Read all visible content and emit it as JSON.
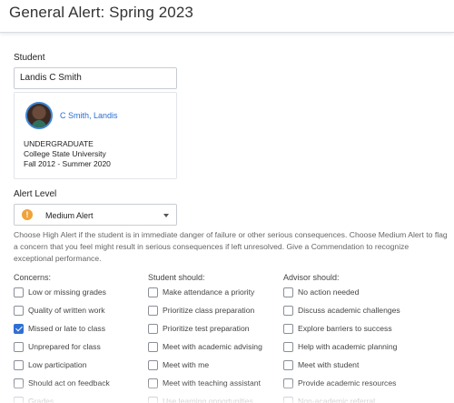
{
  "header": {
    "title": "General Alert: Spring 2023"
  },
  "student": {
    "label": "Student",
    "value": "Landis  C Smith",
    "card": {
      "name": "C Smith, Landis",
      "level": "UNDERGRADUATE",
      "school": "College State University",
      "term": "Fall 2012 - Summer 2020"
    }
  },
  "alert_level": {
    "label": "Alert Level",
    "selected": "Medium Alert",
    "icon": "warning-icon",
    "icon_color": "#f0a23a",
    "help": "Choose High Alert if the student is in immediate danger of failure or other serious consequences. Choose Medium Alert to flag a concern that you feel might result in serious consequences if left unresolved. Give a Commendation to recognize exceptional performance."
  },
  "columns": {
    "concerns": {
      "header": "Concerns:",
      "items": [
        {
          "label": "Low or missing grades",
          "checked": false
        },
        {
          "label": "Quality of written work",
          "checked": false
        },
        {
          "label": "Missed or late to class",
          "checked": true
        },
        {
          "label": "Unprepared for class",
          "checked": false
        },
        {
          "label": "Low participation",
          "checked": false
        },
        {
          "label": "Should act on feedback",
          "checked": false
        },
        {
          "label": "Grades",
          "checked": false
        }
      ]
    },
    "student_should": {
      "header": "Student should:",
      "items": [
        {
          "label": "Make attendance a priority",
          "checked": false
        },
        {
          "label": "Prioritize class preparation",
          "checked": false
        },
        {
          "label": "Prioritize test preparation",
          "checked": false
        },
        {
          "label": "Meet with academic advising",
          "checked": false
        },
        {
          "label": "Meet with me",
          "checked": false
        },
        {
          "label": "Meet with teaching assistant",
          "checked": false
        },
        {
          "label": "Use learning opportunities",
          "checked": false
        }
      ]
    },
    "advisor_should": {
      "header": "Advisor should:",
      "items": [
        {
          "label": "No action needed",
          "checked": false
        },
        {
          "label": "Discuss academic challenges",
          "checked": false
        },
        {
          "label": "Explore barriers to success",
          "checked": false
        },
        {
          "label": "Help with academic planning",
          "checked": false
        },
        {
          "label": "Meet with student",
          "checked": false
        },
        {
          "label": "Provide academic resources",
          "checked": false
        },
        {
          "label": "Non-academic referral",
          "checked": false
        }
      ]
    }
  },
  "colors": {
    "accent": "#2f6fd4",
    "link": "#2b6fd0"
  }
}
